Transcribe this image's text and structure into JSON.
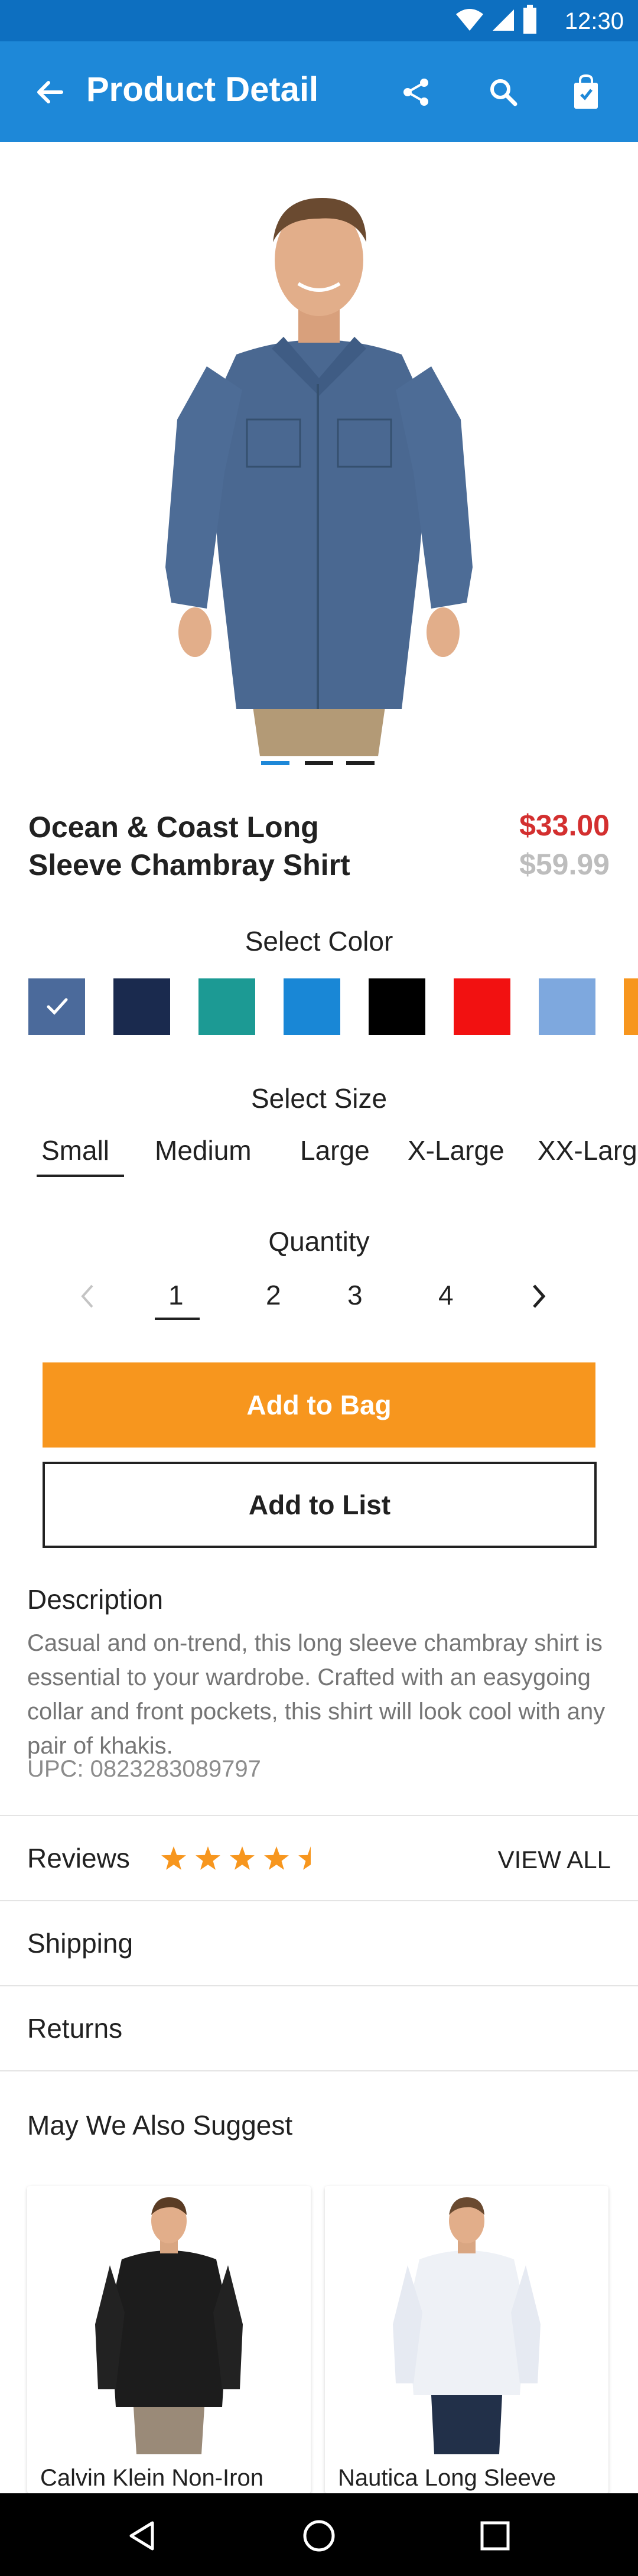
{
  "status_bar": {
    "time": "12:30"
  },
  "app_bar": {
    "title": "Product Detail",
    "icons": [
      "back-arrow-icon",
      "share-icon",
      "search-icon",
      "shopping-bag-icon"
    ]
  },
  "product": {
    "title": "Ocean & Coast Long Sleeve Chambray Shirt",
    "price": "$33.00",
    "original_price": "$59.99",
    "image_pages": 3,
    "current_image_page": 1
  },
  "color": {
    "label": "Select Color",
    "swatches": [
      "#4b6a9b",
      "#1a2a4e",
      "#1c9a94",
      "#1987d6",
      "#000000",
      "#f21111",
      "#7ea8de",
      "#f7961e"
    ],
    "selected_index": 0
  },
  "size": {
    "label": "Select Size",
    "options": [
      "Small",
      "Medium",
      "Large",
      "X-Large",
      "XX-Large"
    ],
    "selected": "Small"
  },
  "quantity": {
    "label": "Quantity",
    "options": [
      "1",
      "2",
      "3",
      "4"
    ],
    "selected": "1"
  },
  "actions": {
    "add_to_bag": "Add to Bag",
    "add_to_list": "Add to List"
  },
  "description": {
    "heading": "Description",
    "text": "Casual and on-trend, this long sleeve chambray shirt is essential to your wardrobe. Crafted with an easygoing collar and front pockets, this shirt will look cool with any pair of khakis.",
    "upc": "UPC: 0823283089797"
  },
  "reviews": {
    "label": "Reviews",
    "rating": 4.5,
    "view_all": "VIEW ALL"
  },
  "shipping": {
    "label": "Shipping"
  },
  "returns": {
    "label": "Returns"
  },
  "suggestions": {
    "heading": "May We Also Suggest",
    "items": [
      {
        "name": "Calvin Klein Non-Iron Long Sleeve Button-Down Shirt"
      },
      {
        "name": "Nautica Long Sleeve Wrinkle Resistant Blue"
      }
    ]
  },
  "colors": {
    "primary": "#1e88d8",
    "status_bar": "#0d6fc0",
    "accent": "#f7961e",
    "price": "#d32f2f",
    "old_price": "#bdbdbd"
  }
}
